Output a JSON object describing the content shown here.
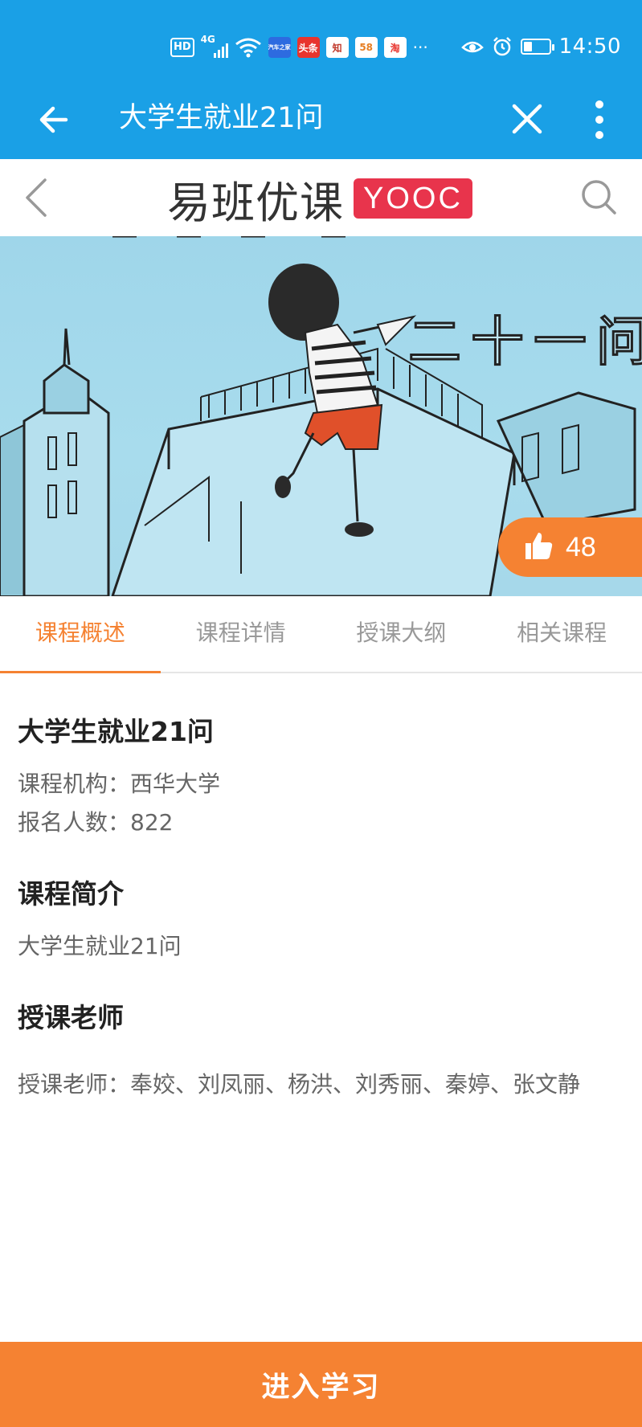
{
  "status_bar": {
    "hd": "HD",
    "network": "4G",
    "app_icon_labels": [
      "汽车之家",
      "头条",
      "知",
      "58",
      "淘"
    ],
    "overflow": "···",
    "time": "14:50"
  },
  "app_bar": {
    "title": "大学生就业21问"
  },
  "site_header": {
    "logo_cn": "易班优课",
    "logo_en": "YOOC"
  },
  "banner": {
    "overlay_text": "二十一问",
    "like_count": "48"
  },
  "tabs": [
    {
      "label": "课程概述",
      "active": true
    },
    {
      "label": "课程详情",
      "active": false
    },
    {
      "label": "授课大纲",
      "active": false
    },
    {
      "label": "相关课程",
      "active": false
    }
  ],
  "course": {
    "title": "大学生就业21问",
    "org_label": "课程机构：",
    "org_value": "西华大学",
    "enroll_label": "报名人数：",
    "enroll_value": "822",
    "intro_heading": "课程简介",
    "intro_text": "大学生就业21问",
    "teacher_heading": "授课老师",
    "teacher_text": "授课老师：奉姣、刘凤丽、杨洪、刘秀丽、秦婷、张文静"
  },
  "bottom_button": {
    "label": "进入学习"
  },
  "colors": {
    "primary_blue": "#1aa0e6",
    "accent_orange": "#f58232",
    "logo_red": "#e8344c"
  }
}
